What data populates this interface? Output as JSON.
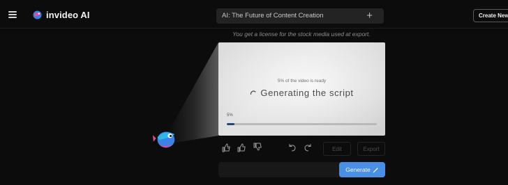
{
  "header": {
    "brand": "invideo AI",
    "project_title": "AI: The Future of Content Creation",
    "add_label": "+",
    "create_new_label": "Create New"
  },
  "notice": "You get a license for the stock media used at export.",
  "preview": {
    "status_small": "5% of the video is ready",
    "status_main": "Generating the script",
    "progress_label": "5%",
    "progress": 0.05
  },
  "toolbar": {
    "edit_label": "Edit",
    "export_label": "Export",
    "icons": [
      "thumbs-up-double-icon",
      "thumbs-up-icon",
      "thumbs-down-icon",
      "undo-icon",
      "redo-icon"
    ]
  },
  "prompt": {
    "value": "",
    "placeholder": "",
    "generate_label": "Generate"
  },
  "colors": {
    "accent": "#4a8fe6",
    "progress_fill": "#24457a",
    "background": "#0c0c0c"
  }
}
